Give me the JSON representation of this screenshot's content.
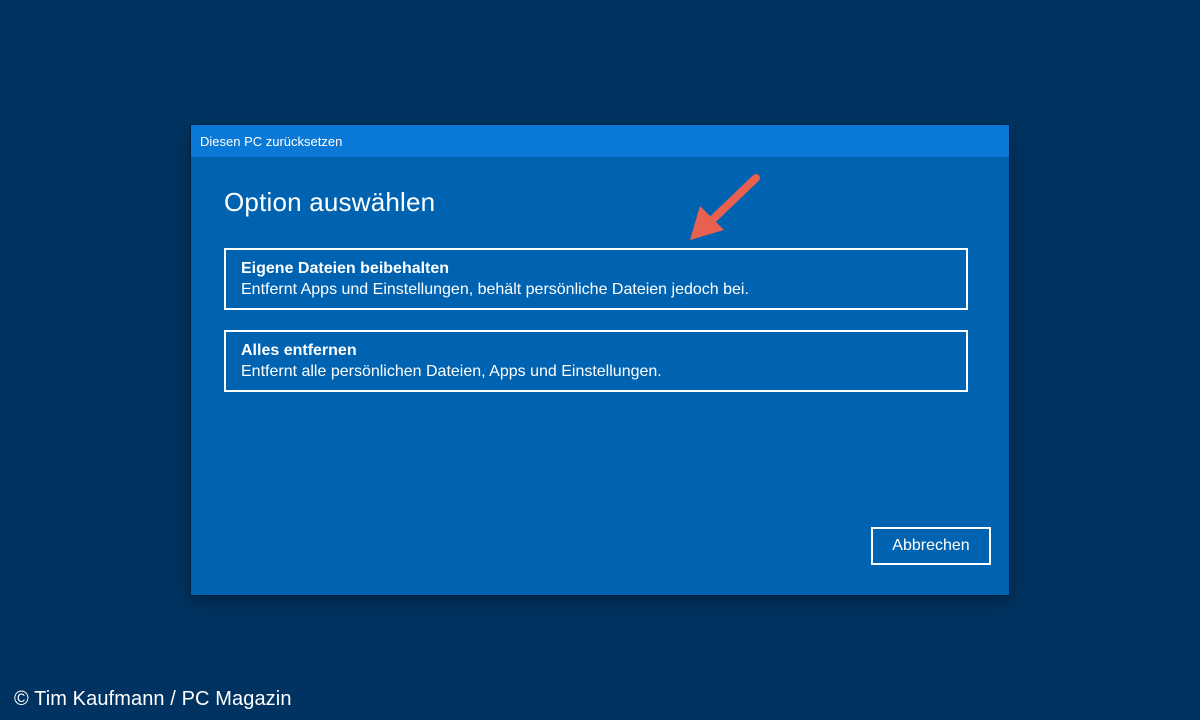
{
  "dialog": {
    "title": "Diesen PC zurücksetzen",
    "heading": "Option auswählen",
    "options": [
      {
        "title": "Eigene Dateien beibehalten",
        "description": "Entfernt Apps und Einstellungen, behält persönliche Dateien jedoch bei."
      },
      {
        "title": "Alles entfernen",
        "description": "Entfernt alle persönlichen Dateien, Apps und Einstellungen."
      }
    ],
    "cancel_label": "Abbrechen"
  },
  "annotation": {
    "icon": "pointer-arrow-icon",
    "color": "#e8604f"
  },
  "credit": "© Tim Kaufmann / PC Magazin",
  "colors": {
    "background": "#003361",
    "dialog": "#0063b1",
    "titlebar": "#0a78d7",
    "text": "#ffffff"
  }
}
